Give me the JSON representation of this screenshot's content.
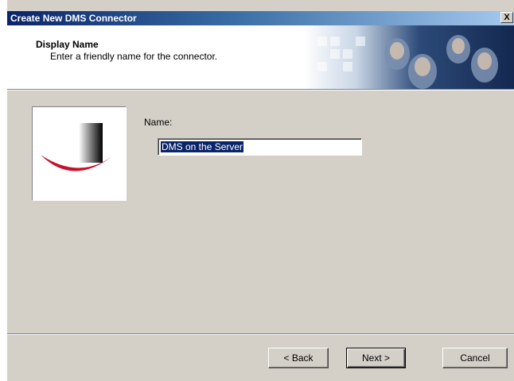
{
  "window": {
    "title": "Create New DMS Connector",
    "close_glyph": "X"
  },
  "header": {
    "title": "Display Name",
    "subtitle": "Enter a friendly name for the connector."
  },
  "form": {
    "name_label": "Name:",
    "name_value": "DMS on the Server"
  },
  "buttons": {
    "back": "< Back",
    "next": "Next >",
    "cancel": "Cancel"
  },
  "colors": {
    "titlebar_start": "#0a246a",
    "dialog_bg": "#d4d0c8",
    "selection_bg": "#0a246a",
    "logo_red": "#c8102e"
  },
  "icons": {
    "header_image": "people-photo-banner",
    "logo": "dms-logo"
  }
}
